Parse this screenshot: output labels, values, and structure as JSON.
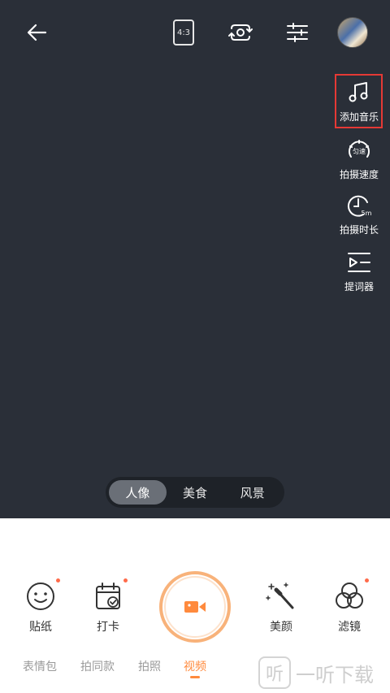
{
  "topbar": {
    "back_icon": "arrow-left-icon",
    "ratio_label": "4:3",
    "flip_icon": "camera-flip-icon",
    "settings_icon": "sliders-icon",
    "avatar_icon": "avatar"
  },
  "side_tools": [
    {
      "label": "添加音乐",
      "icon": "music-note-icon",
      "highlighted": true
    },
    {
      "label": "拍摄速度",
      "icon": "speed-dial-icon",
      "badge": "匀速"
    },
    {
      "label": "拍摄时长",
      "icon": "clock-icon",
      "badge": "5m"
    },
    {
      "label": "提词器",
      "icon": "teleprompter-icon"
    }
  ],
  "modes": {
    "items": [
      "人像",
      "美食",
      "风景"
    ],
    "selected": "人像"
  },
  "bottom_tools": [
    {
      "label": "贴纸",
      "icon": "smiley-icon",
      "dot": true
    },
    {
      "label": "打卡",
      "icon": "calendar-check-icon",
      "dot": true
    },
    {
      "label": "美颜",
      "icon": "magic-wand-icon",
      "dot": false
    },
    {
      "label": "滤镜",
      "icon": "filter-circles-icon",
      "dot": true
    }
  ],
  "shutter": {
    "icon": "video-camera-icon"
  },
  "tabs": {
    "items": [
      "表情包",
      "拍同款",
      "拍照",
      "视频"
    ],
    "selected": "视频"
  },
  "watermark": {
    "badge": "听",
    "text": "一听下载"
  },
  "colors": {
    "camera_bg": "#2a2f38",
    "accent": "#ff8a3d",
    "highlight": "#e53935"
  }
}
